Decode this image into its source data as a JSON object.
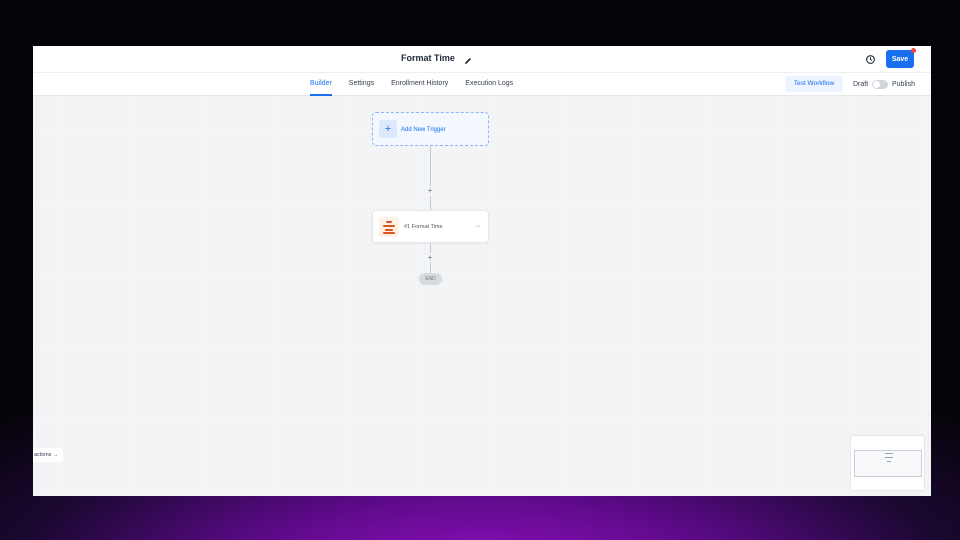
{
  "header": {
    "workflow_title": "Format Time",
    "save_label": "Save"
  },
  "tabs": [
    {
      "label": "Builder",
      "active": true
    },
    {
      "label": "Settings",
      "active": false
    },
    {
      "label": "Enrollment History",
      "active": false
    },
    {
      "label": "Execution Logs",
      "active": false
    }
  ],
  "toolbar": {
    "test_workflow_label": "Test Workflow",
    "draft_label": "Draft",
    "publish_label": "Publish",
    "publish_enabled": false
  },
  "canvas": {
    "trigger_label": "Add New Trigger",
    "action_label": "#1 Format Time",
    "end_label": "END",
    "actions_panel_label": "actions"
  },
  "icons": {
    "edit": "pencil-icon",
    "history": "clock-history-icon",
    "trigger_add": "plus-icon",
    "action": "format-time-icon",
    "more": "more-horizontal-icon",
    "actions_arrow": "arrow-right-icon"
  },
  "colors": {
    "accent": "#1a6ef0",
    "notification": "#ef4444",
    "action_icon": "#d9541e"
  }
}
